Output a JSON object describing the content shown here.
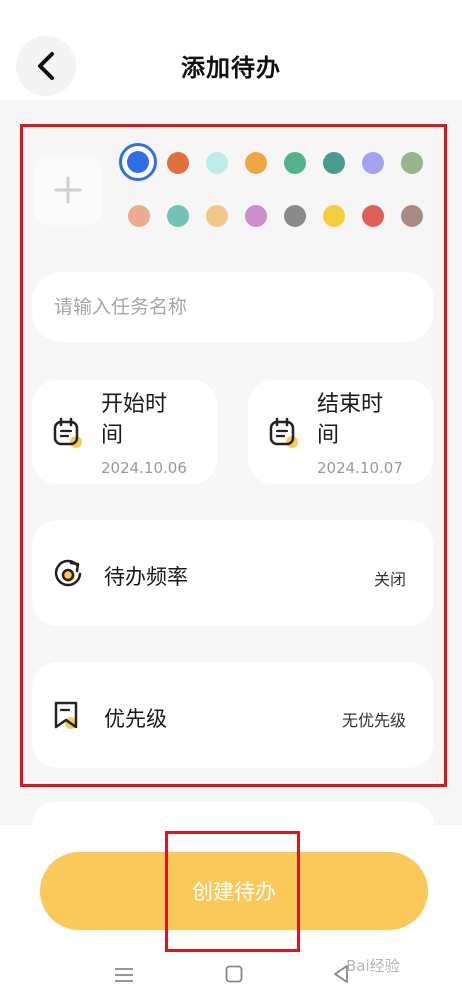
{
  "header": {
    "title": "添加待办",
    "back_icon": "chevron-left-icon"
  },
  "colors": {
    "selected": "#2e6ee6",
    "row1": [
      "#e0703f",
      "#bfeaea",
      "#f2a544",
      "#52b28a",
      "#4a9a8f",
      "#a3a2ee",
      "#98b58a"
    ],
    "row2": [
      "#ebab90",
      "#74c1b7",
      "#f1c88a",
      "#ce8fcd",
      "#8a8a8a",
      "#f4cf3d",
      "#df6059",
      "#a88a80"
    ]
  },
  "task_name": {
    "placeholder": "请输入任务名称",
    "value": ""
  },
  "start_time": {
    "label": "开始时间",
    "date": "2024.10.06"
  },
  "end_time": {
    "label": "结束时间",
    "date": "2024.10.07"
  },
  "frequency": {
    "label": "待办频率",
    "value": "关闭"
  },
  "priority": {
    "label": "优先级",
    "value": "无优先级"
  },
  "create_button": {
    "label": "创建待办"
  },
  "watermark": {
    "text": "Bai经验"
  },
  "accent_color": "#fac95a",
  "annotation_color": "#e0141e"
}
